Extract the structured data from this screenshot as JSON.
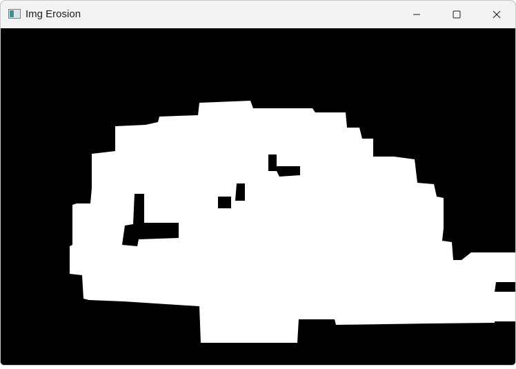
{
  "window": {
    "title": "Img Erosion",
    "controls": {
      "minimize_icon": "minimize-icon",
      "maximize_icon": "maximize-icon",
      "close_icon": "close-icon"
    }
  },
  "canvas": {
    "description_color_foreground": "#ffffff",
    "description_color_background": "#000000"
  }
}
